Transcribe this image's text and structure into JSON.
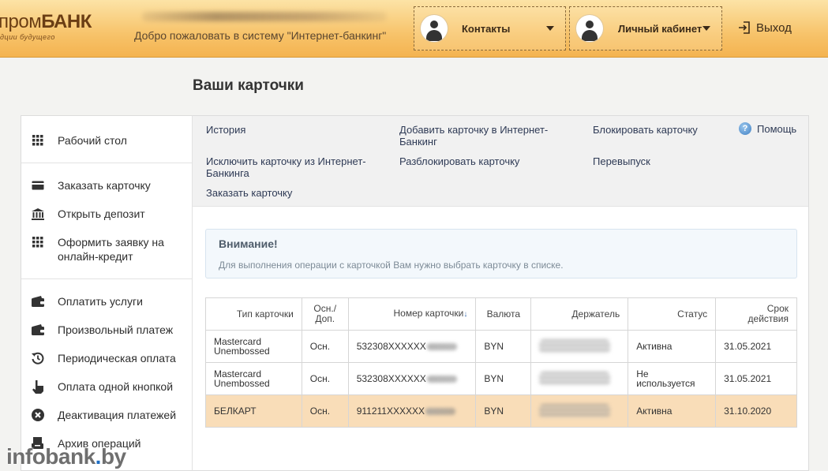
{
  "header": {
    "logo_text": "пром",
    "logo_bold": "БАНК",
    "logo_tagline": "дции будущего",
    "welcome": "Добро пожаловать в систему \"Интернет-банкинг\"",
    "contacts_label": "Контакты",
    "cabinet_label": "Личный кабинет",
    "logout_label": "Выход"
  },
  "page": {
    "title": "Ваши карточки"
  },
  "sidebar": {
    "groups": [
      [
        {
          "label": "Рабочий стол",
          "icon": "grid-icon"
        }
      ],
      [
        {
          "label": "Заказать карточку",
          "icon": "card-icon"
        },
        {
          "label": "Открыть депозит",
          "icon": "bank-icon"
        },
        {
          "label": "Оформить заявку на онлайн-кредит",
          "icon": "grid-icon"
        }
      ],
      [
        {
          "label": "Оплатить услуги",
          "icon": "wallet-icon"
        },
        {
          "label": "Произвольный платеж",
          "icon": "wallet-icon"
        },
        {
          "label": "Периодическая оплата",
          "icon": "history-icon"
        },
        {
          "label": "Оплата одной кнопкой",
          "icon": "hand-pointer-icon"
        },
        {
          "label": "Деактивация платежей",
          "icon": "cancel-circle-icon"
        },
        {
          "label": "Архив операций",
          "icon": "archive-icon"
        }
      ]
    ]
  },
  "actions": {
    "history": "История",
    "add_card": "Добавить карточку в Интернет-Банкинг",
    "block_card": "Блокировать карточку",
    "remove_card": "Исключить карточку из Интернет-Банкинга",
    "unblock_card": "Разблокировать карточку",
    "reissue": "Перевыпуск",
    "order_card": "Заказать карточку",
    "help": "Помощь"
  },
  "alert": {
    "title": "Внимание!",
    "message": "Для выполнения операции с карточкой Вам нужно выбрать карточку в списке."
  },
  "table": {
    "headers": [
      "Тип карточки",
      "Осн./ Доп.",
      "Номер карточки",
      "Валюта",
      "Держатель",
      "Статус",
      "Срок действия"
    ],
    "rows": [
      {
        "type": "Mastercard Unembossed",
        "main": "Осн.",
        "number": "532308XXXXXX",
        "currency": "BYN",
        "status": "Активна",
        "expiry": "31.05.2021"
      },
      {
        "type": "Mastercard Unembossed",
        "main": "Осн.",
        "number": "532308XXXXXX",
        "currency": "BYN",
        "status": "Не используется",
        "expiry": "31.05.2021"
      },
      {
        "type": "БЕЛКАРТ",
        "main": "Осн.",
        "number": "911211XXXXXX",
        "currency": "BYN",
        "status": "Активна",
        "expiry": "31.10.2020"
      }
    ]
  },
  "watermark": {
    "pre": "infobank",
    "dot": ".",
    "post": "by"
  }
}
